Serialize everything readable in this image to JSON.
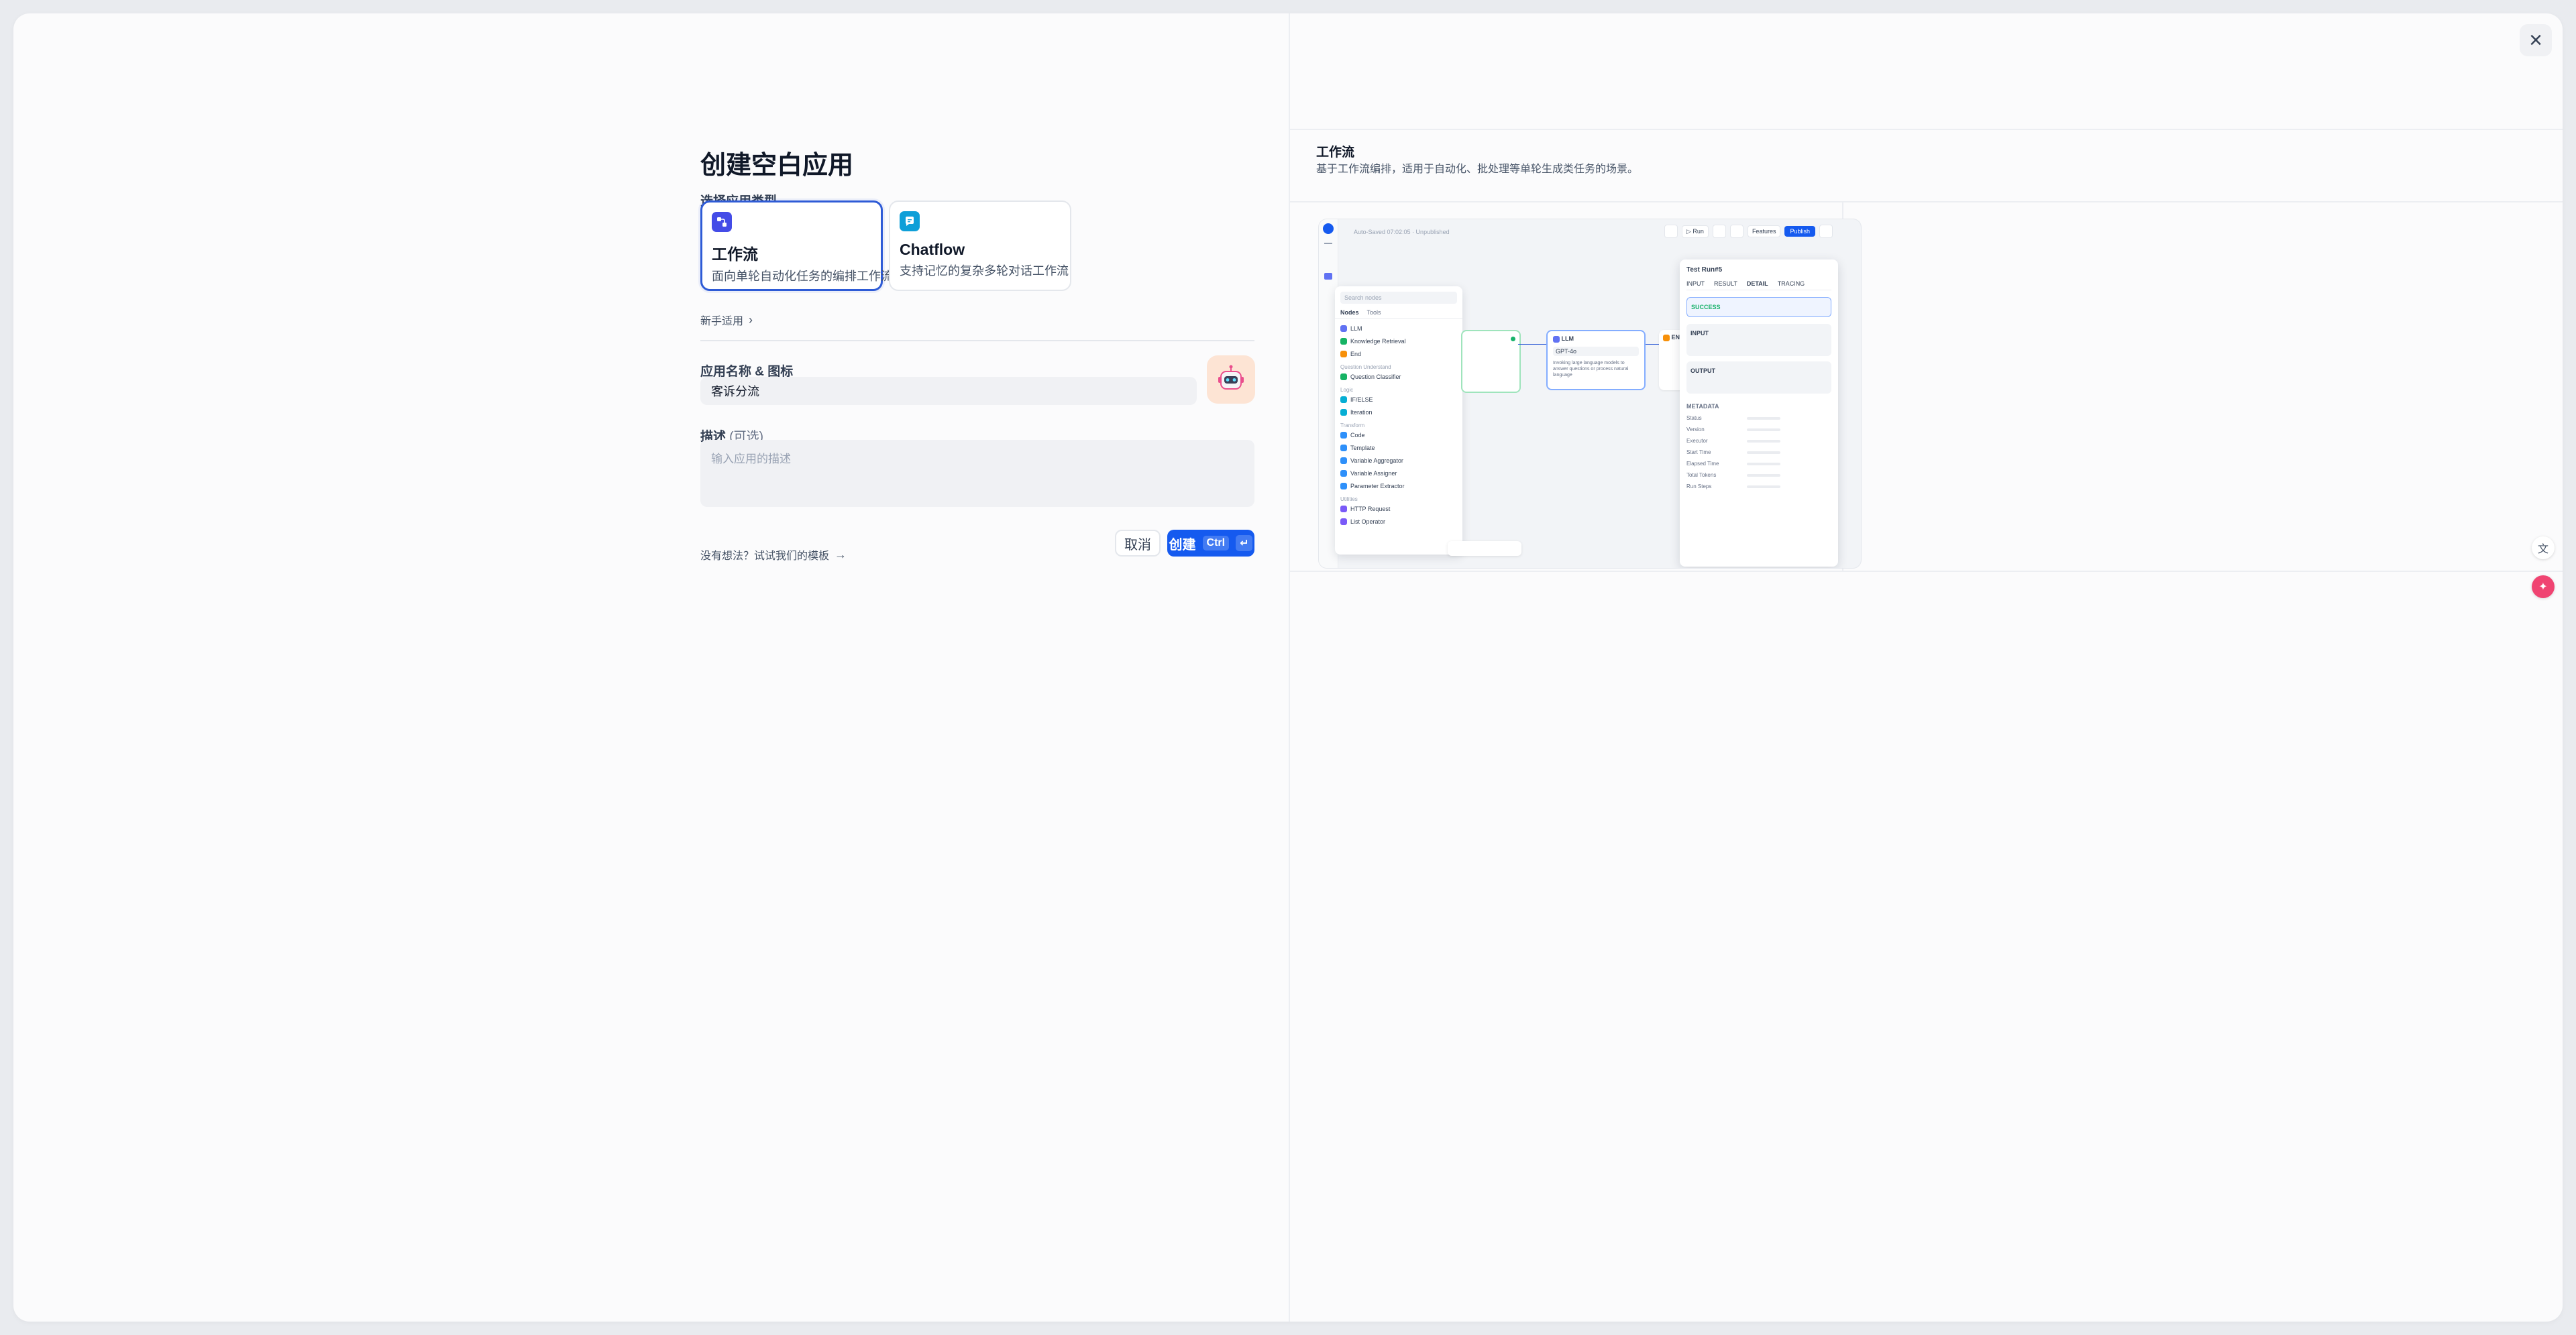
{
  "dialog": {
    "close_icon": "close-icon",
    "title": "创建空白应用",
    "app_type_label": "选择应用类型",
    "app_types": [
      {
        "title": "工作流",
        "desc": "面向单轮自动化任务的编排工作流",
        "icon": "workflow-icon",
        "color": "#444ce7",
        "selected": true
      },
      {
        "title": "Chatflow",
        "desc": "支持记忆的复杂多轮对话工作流",
        "icon": "chatflow-icon",
        "color": "#0e9fd8",
        "selected": false
      }
    ],
    "beginner_link": "新手适用",
    "name_label": "应用名称 & 图标",
    "name_value": "客诉分流",
    "desc_label": "描述",
    "desc_optional": "(可选)",
    "desc_placeholder": "输入应用的描述",
    "template_link": "没有想法？试试我们的模板",
    "cancel_label": "取消",
    "create_label": "创建",
    "create_shortcut": "Ctrl",
    "primary_color": "#155aef"
  },
  "preview_panel": {
    "title": "工作流",
    "desc": "基于工作流编排，适用于自动化、批处理等单轮生成类任务的场景。",
    "screenshot": {
      "autosave": "Auto-Saved 07:02:05 · Unpublished",
      "run_label": "Run",
      "features_label": "Features",
      "publish_label": "Publish",
      "search_placeholder": "Search nodes",
      "tabs": [
        "Nodes",
        "Tools"
      ],
      "node_list": [
        {
          "label": "LLM",
          "color": "#6172f3"
        },
        {
          "label": "Knowledge Retrieval",
          "color": "#16b364"
        },
        {
          "label": "End",
          "color": "#f79009"
        }
      ],
      "groups": [
        {
          "name": "Question Understand",
          "items": [
            {
              "label": "Question Classifier",
              "color": "#16b364"
            }
          ]
        },
        {
          "name": "Logic",
          "items": [
            {
              "label": "IF/ELSE",
              "color": "#06aed4"
            },
            {
              "label": "Iteration",
              "color": "#06aed4"
            }
          ]
        },
        {
          "name": "Transform",
          "items": [
            {
              "label": "Code",
              "color": "#2e90fa"
            },
            {
              "label": "Template",
              "color": "#2e90fa"
            },
            {
              "label": "Variable Aggregator",
              "color": "#2e90fa"
            },
            {
              "label": "Variable Assigner",
              "color": "#2e90fa"
            },
            {
              "label": "Parameter Extractor",
              "color": "#2e90fa"
            }
          ]
        },
        {
          "name": "Utilities",
          "items": [
            {
              "label": "HTTP Request",
              "color": "#7a5af8"
            },
            {
              "label": "List Operator",
              "color": "#7a5af8"
            }
          ]
        }
      ],
      "llm_node": {
        "title": "LLM",
        "model": "GPT-4o",
        "desc": "Invoking large language models to answer questions or process natural language"
      },
      "end_node": "END",
      "test_panel": {
        "title": "Test Run#5",
        "tabs": [
          "INPUT",
          "RESULT",
          "DETAIL",
          "TRACING"
        ],
        "active_tab": "DETAIL",
        "status": "SUCCESS",
        "sections": [
          "INPUT",
          "OUTPUT",
          "METADATA"
        ],
        "metadata": [
          "Status",
          "Version",
          "Executor",
          "Start Time",
          "Elapsed Time",
          "Total Tokens",
          "Run Steps"
        ]
      }
    }
  },
  "floating": {
    "icons": [
      "translate-icon",
      "assistant-icon"
    ]
  }
}
